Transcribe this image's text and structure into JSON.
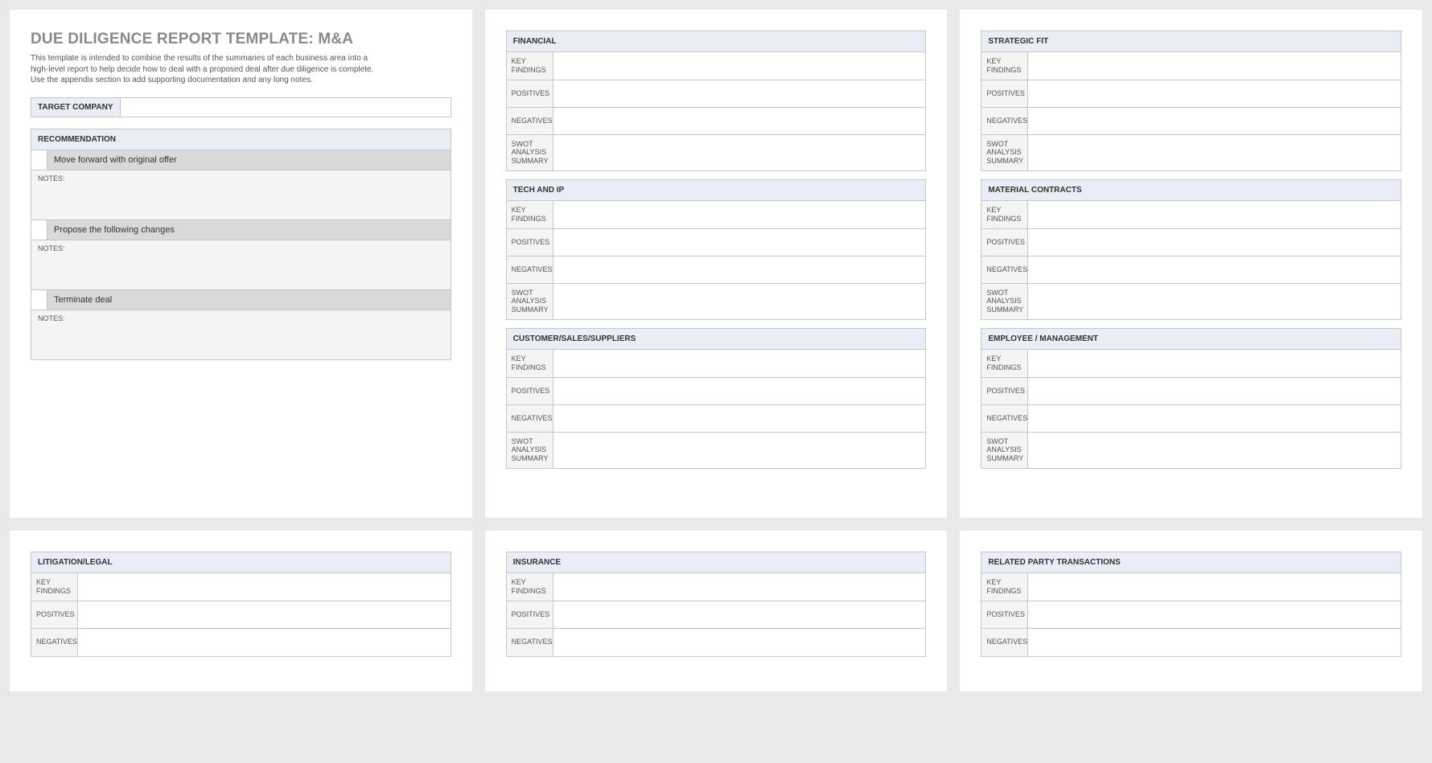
{
  "title": "DUE DILIGENCE REPORT TEMPLATE: M&A",
  "intro": "This template is intended to combine the results of the summaries of each business area into a high-level report to help decide how to deal with a proposed deal after due diligence is complete.  Use the appendix section to add supporting documentation and any long notes.",
  "target_company_label": "TARGET COMPANY",
  "target_company_value": "",
  "recommendation_header": "RECOMMENDATION",
  "options": [
    {
      "label": "Move forward with original offer",
      "notes_label": "NOTES:",
      "notes": ""
    },
    {
      "label": "Propose the following changes",
      "notes_label": "NOTES:",
      "notes": ""
    },
    {
      "label": "Terminate deal",
      "notes_label": "NOTES:",
      "notes": ""
    }
  ],
  "row_labels": {
    "key_findings": "KEY FINDINGS",
    "positives": "POSITIVES",
    "negatives": "NEGATIVES",
    "swot": "SWOT ANALYSIS SUMMARY"
  },
  "sections": {
    "financial": "FINANCIAL",
    "tech_ip": "TECH AND IP",
    "customer": "CUSTOMER/SALES/SUPPLIERS",
    "strategic": "STRATEGIC FIT",
    "material": "MATERIAL CONTRACTS",
    "employee": "EMPLOYEE / MANAGEMENT",
    "litigation": "LITIGATION/LEGAL",
    "insurance": "INSURANCE",
    "related": "RELATED PARTY TRANSACTIONS"
  }
}
